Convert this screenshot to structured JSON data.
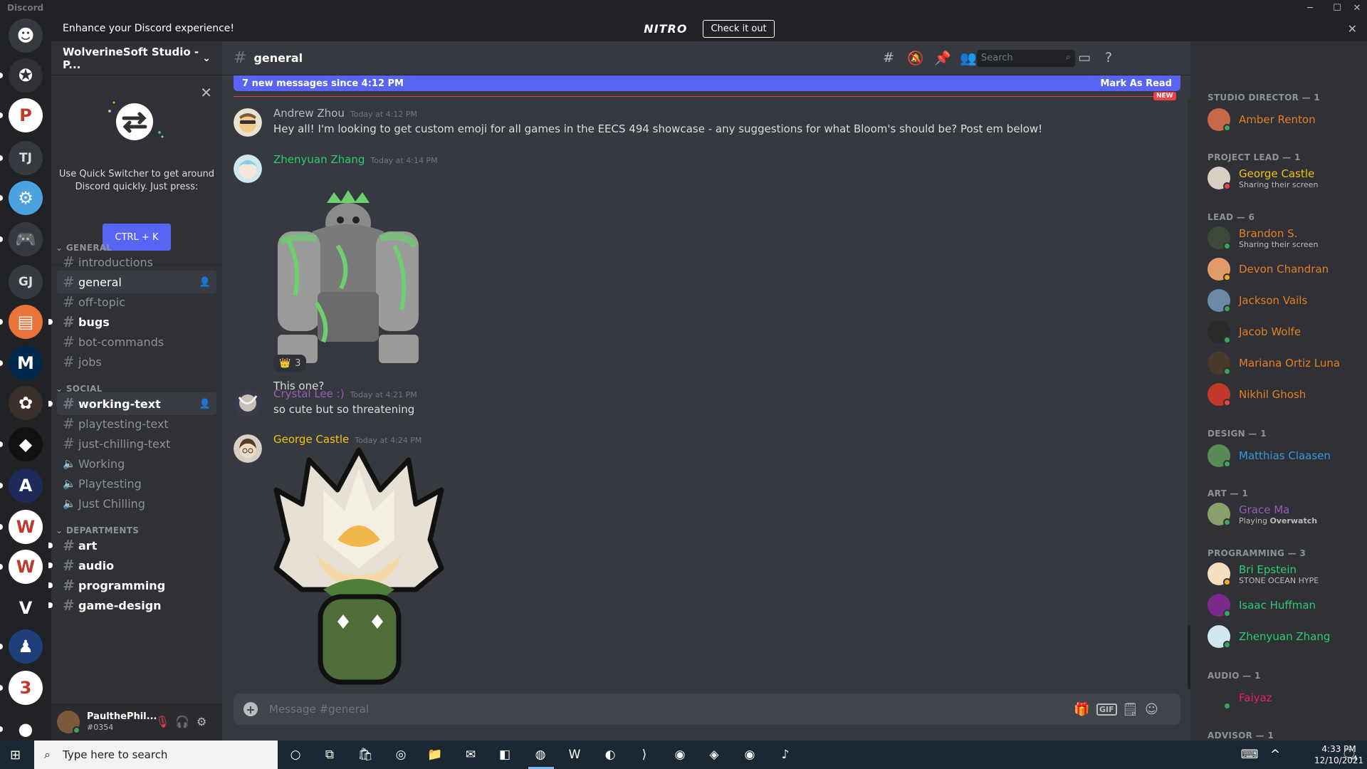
{
  "window": {
    "app_title": "Discord",
    "minimize": "─",
    "maximize": "☐",
    "close": "✕"
  },
  "nitro": {
    "logo": "NITRO",
    "message": "Enhance your Discord experience!",
    "button": "Check it out",
    "close": "✕"
  },
  "server_rail": {
    "items": [
      {
        "label": "",
        "icon": "discord-home-icon",
        "color": "#36393f"
      },
      {
        "label": "",
        "icon": "compass-emblem-icon",
        "color": "#2f3136"
      },
      {
        "label": "",
        "icon": "p-logo-icon",
        "color": "#ffffff"
      },
      {
        "label": "TJ",
        "icon": "",
        "color": "#36393f"
      },
      {
        "label": "",
        "icon": "mascot-gear-icon",
        "color": "#4aa3df"
      },
      {
        "label": "",
        "icon": "game-controller-icon",
        "color": "#36393f"
      },
      {
        "label": "GJ",
        "icon": "",
        "color": "#36393f"
      },
      {
        "label": "",
        "icon": "lantern-icon",
        "color": "#e8743b"
      },
      {
        "label": "",
        "icon": "m-block-icon",
        "color": "#00274c"
      },
      {
        "label": "",
        "icon": "bloom-art-icon",
        "color": "#3a2f2a"
      },
      {
        "label": "",
        "icon": "colorful-shapes-icon",
        "color": "#111111"
      },
      {
        "label": "",
        "icon": "michigan-animation-icon",
        "color": "#1e2a5a"
      },
      {
        "label": "",
        "icon": "wolverinesoft-icon",
        "color": "#ffffff"
      },
      {
        "label": "",
        "icon": "wolverinesoft-studio-icon",
        "color": "#ffffff"
      },
      {
        "label": "",
        "icon": "vtag-games-icon",
        "color": "#202225"
      },
      {
        "label": "",
        "icon": "pawn-icon",
        "color": "#1e3f7a"
      },
      {
        "label": "",
        "icon": "flame-icon",
        "color": "#ffffff"
      },
      {
        "label": "",
        "icon": "chip-icon",
        "color": "#202225"
      }
    ]
  },
  "guild": {
    "name": "WolverineSoft Studio - P...",
    "chevron": "⌄"
  },
  "quick_switcher": {
    "close": "✕",
    "text": "Use Quick Switcher to get around Discord quickly. Just press:",
    "shortcut": "CTRL + K"
  },
  "categories": {
    "general": "GENERAL",
    "social": "SOCIAL",
    "departments": "DEPARTMENTS",
    "caret": "⌄"
  },
  "channels": {
    "introductions": "introductions",
    "general": "general",
    "off_topic": "off-topic",
    "bugs": "bugs",
    "bot_commands": "bot-commands",
    "jobs": "jobs",
    "working_text": "working-text",
    "playtesting_text": "playtesting-text",
    "just_chilling_text": "just-chilling-text",
    "working": "Working",
    "playtesting": "Playtesting",
    "just_chilling": "Just Chilling",
    "art": "art",
    "audio": "audio",
    "programming": "programming",
    "game_design": "game-design"
  },
  "user": {
    "name": "PaulthePhil...",
    "tag": "#0354"
  },
  "header": {
    "channel": "general"
  },
  "search": {
    "placeholder": "Search"
  },
  "new_messages": {
    "text": "7 new messages since 4:12 PM",
    "action": "Mark As Read",
    "tag": "NEW"
  },
  "messages": {
    "m1": {
      "author": "Andrew Zhou",
      "time": "Today at 4:12 PM",
      "text": "Hey all! I'm looking to get custom emoji for all games in the EECS 494 showcase - any suggestions for what Bloom's should be? Post em below!"
    },
    "m2": {
      "author": "Zhenyuan Zhang",
      "time": "Today at 4:14 PM",
      "reaction_emoji": "👑",
      "reaction_count": "3",
      "text": "This one?"
    },
    "m3": {
      "author": "Crystal Lee :)",
      "time": "Today at 4:21 PM",
      "text": "so cute but so threatening"
    },
    "m4": {
      "author": "George Castle",
      "time": "Today at 4:24 PM"
    }
  },
  "composer": {
    "placeholder": "Message #general",
    "gif": "GIF"
  },
  "roles": {
    "studio_director": "STUDIO DIRECTOR — 1",
    "project_lead": "PROJECT LEAD — 1",
    "lead": "LEAD — 6",
    "design": "DESIGN — 1",
    "art": "ART — 1",
    "programming": "PROGRAMMING — 3",
    "audio": "AUDIO — 1",
    "advisor": "ADVISOR — 1"
  },
  "members": {
    "amber": {
      "name": "Amber Renton"
    },
    "george": {
      "name": "George Castle",
      "status": "Sharing their screen"
    },
    "brandon": {
      "name": "Brandon S.",
      "status": "Sharing their screen"
    },
    "devon": {
      "name": "Devon Chandran"
    },
    "jackson": {
      "name": "Jackson Vails"
    },
    "jacob": {
      "name": "Jacob Wolfe"
    },
    "mariana": {
      "name": "Mariana Ortiz Luna"
    },
    "nikhil": {
      "name": "Nikhil Ghosh"
    },
    "matthias": {
      "name": "Matthias Claasen"
    },
    "grace": {
      "name": "Grace Ma",
      "status_prefix": "Playing ",
      "status_game": "Overwatch"
    },
    "bri": {
      "name": "Bri Epstein",
      "status": "STONE OCEAN HYPE"
    },
    "isaac": {
      "name": "Isaac Huffman"
    },
    "zhenyuan": {
      "name": "Zhenyuan Zhang"
    },
    "faiyaz": {
      "name": "Faiyaz"
    }
  },
  "colors": {
    "blurple": "#5865f2",
    "orange_role": "#e67e22",
    "gold_role": "#f1c40f",
    "green_role": "#2ecc71",
    "blue_role": "#3498db",
    "purple_role": "#9b59b6",
    "red_role": "#e91e63",
    "online": "#3ba55d",
    "dnd": "#ed4245",
    "idle": "#faa81a"
  },
  "taskbar": {
    "search_placeholder": "Type here to search",
    "time": "4:33 PM",
    "date": "12/10/2021",
    "notification_count": "4"
  }
}
